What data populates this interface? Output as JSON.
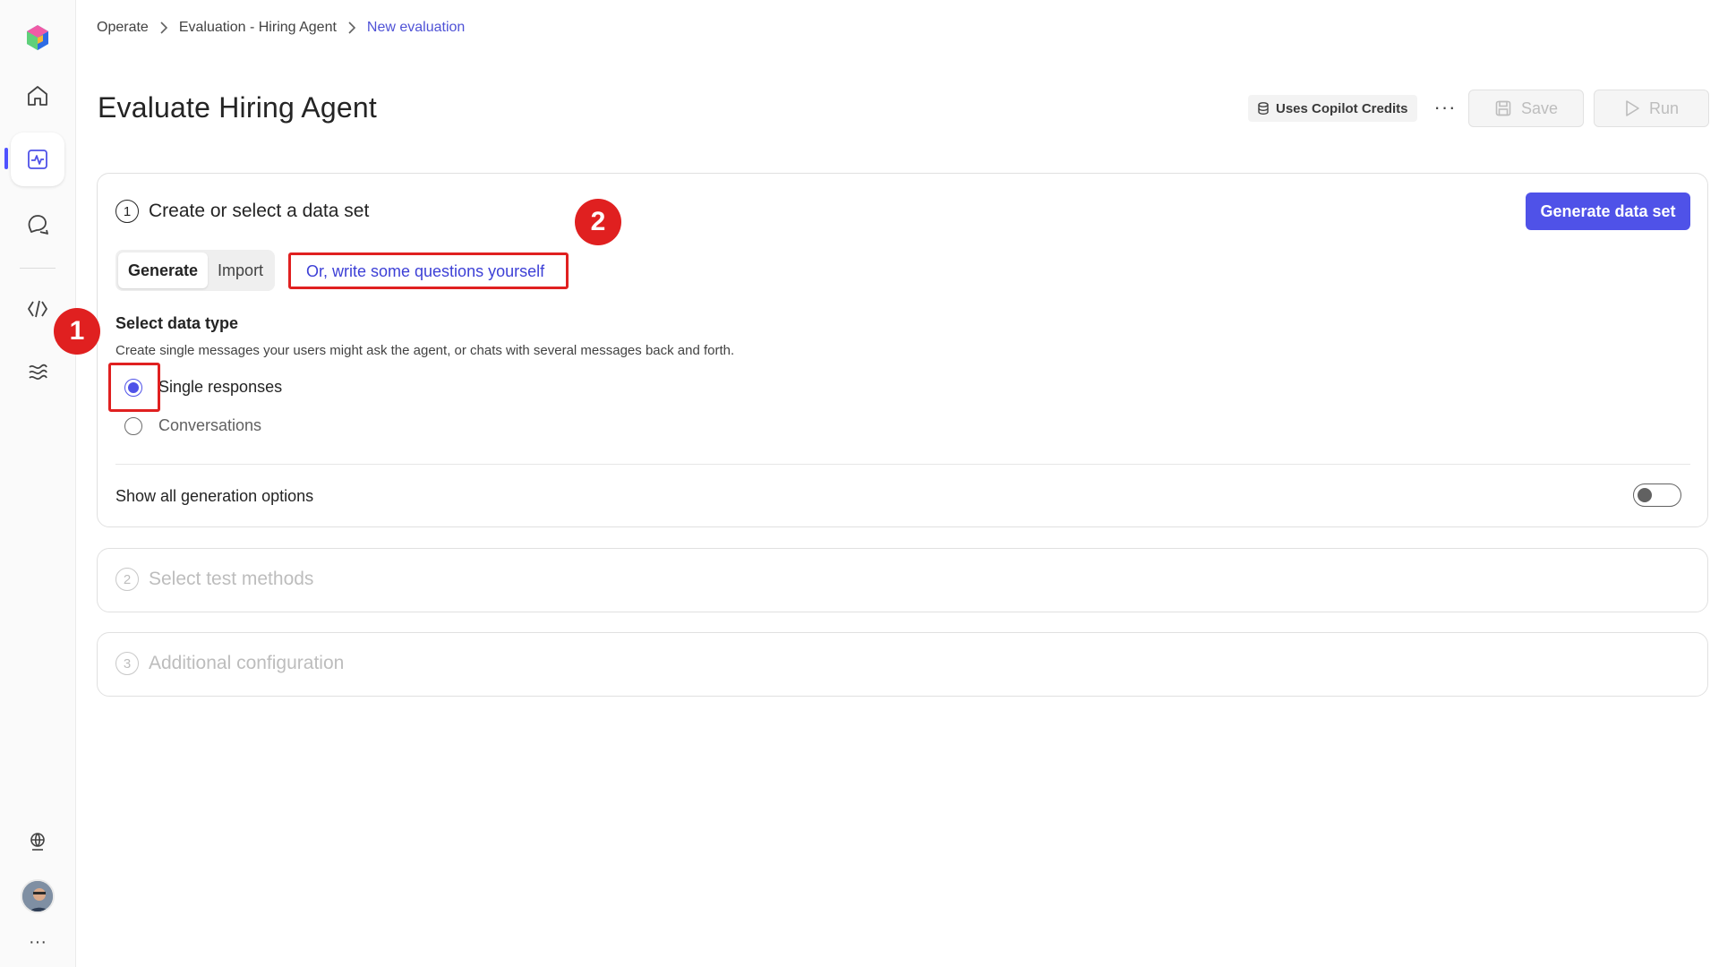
{
  "breadcrumb": {
    "items": [
      "Operate",
      "Evaluation - Hiring Agent"
    ],
    "current": "New evaluation"
  },
  "page": {
    "title": "Evaluate Hiring Agent"
  },
  "toolbar": {
    "credits_label": "Uses Copilot Credits",
    "more_label": "···",
    "save_label": "Save",
    "run_label": "Run"
  },
  "step1": {
    "number": "1",
    "title": "Create or select a data set",
    "generate_button": "Generate data set",
    "tabs": [
      {
        "label": "Generate",
        "selected": true
      },
      {
        "label": "Import",
        "selected": false
      }
    ],
    "write_link": "Or, write some questions yourself",
    "data_type_label": "Select data type",
    "data_type_desc": "Create single messages your users might ask the agent, or chats with several messages back and forth.",
    "options": [
      {
        "label": "Single responses",
        "checked": true
      },
      {
        "label": "Conversations",
        "checked": false
      }
    ],
    "generation_options_label": "Show all generation options",
    "generation_options_on": false
  },
  "step2": {
    "number": "2",
    "title": "Select test methods"
  },
  "step3": {
    "number": "3",
    "title": "Additional configuration"
  },
  "annotations": [
    "1",
    "2"
  ],
  "rail": {
    "more_label": "···"
  },
  "colors": {
    "accent": "#4f52e8",
    "annotation": "#e02020",
    "link": "#3d40d6"
  }
}
